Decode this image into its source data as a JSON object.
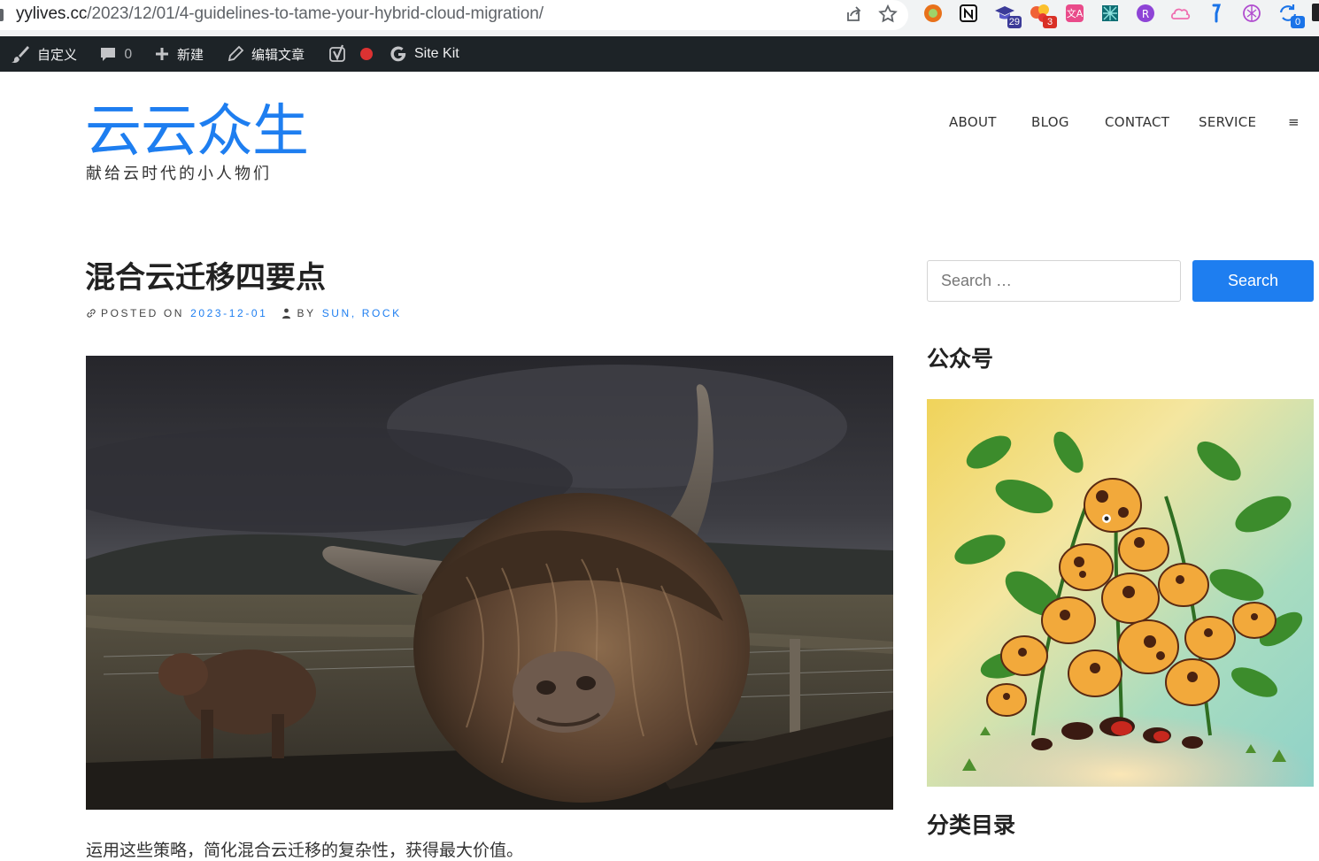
{
  "browser": {
    "url_domain": "yylives.cc",
    "url_path": "/2023/12/01/4-guidelines-to-tame-your-hybrid-cloud-migration/",
    "icons": {
      "share": "share-icon",
      "bookmark": "star-icon"
    },
    "extensions": [
      {
        "name": "extension-circle-icon"
      },
      {
        "name": "notion-icon"
      },
      {
        "name": "graduation-cap-icon",
        "badge": "29",
        "badge_color": "#3b3b98"
      },
      {
        "name": "bubbles-icon",
        "badge": "3",
        "badge_color": "#d93025"
      },
      {
        "name": "translate-icon"
      },
      {
        "name": "geometry-icon"
      },
      {
        "name": "circle-logo-icon"
      },
      {
        "name": "cloud-icon"
      },
      {
        "name": "flag-icon"
      },
      {
        "name": "openai-icon"
      },
      {
        "name": "sync-icon",
        "badge": "0",
        "badge_color": "#1a73e8"
      }
    ]
  },
  "adminbar": {
    "customize": "自定义",
    "comments_count": "0",
    "new": "新建",
    "edit_post": "编辑文章",
    "sitekit": "Site Kit"
  },
  "site": {
    "title": "云云众生",
    "description": "献给云时代的小人物们"
  },
  "nav": {
    "items": [
      "ABOUT",
      "BLOG",
      "CONTACT",
      "SERVICE"
    ],
    "menu_toggle": "≡"
  },
  "post": {
    "title": "混合云迁移四要点",
    "posted_on_label": "POSTED ON",
    "date": "2023-12-01",
    "by_label": "BY",
    "authors": "SUN, ROCK",
    "excerpt": "运用这些策略，简化混合云迁移的复杂性，获得最大价值。"
  },
  "sidebar": {
    "search_placeholder": "Search …",
    "search_button": "Search",
    "widget_wechat": "公众号",
    "widget_categories": "分类目录"
  },
  "colors": {
    "accent": "#1e7ef0",
    "adminbar_bg": "#1d2327",
    "text": "#222222"
  }
}
